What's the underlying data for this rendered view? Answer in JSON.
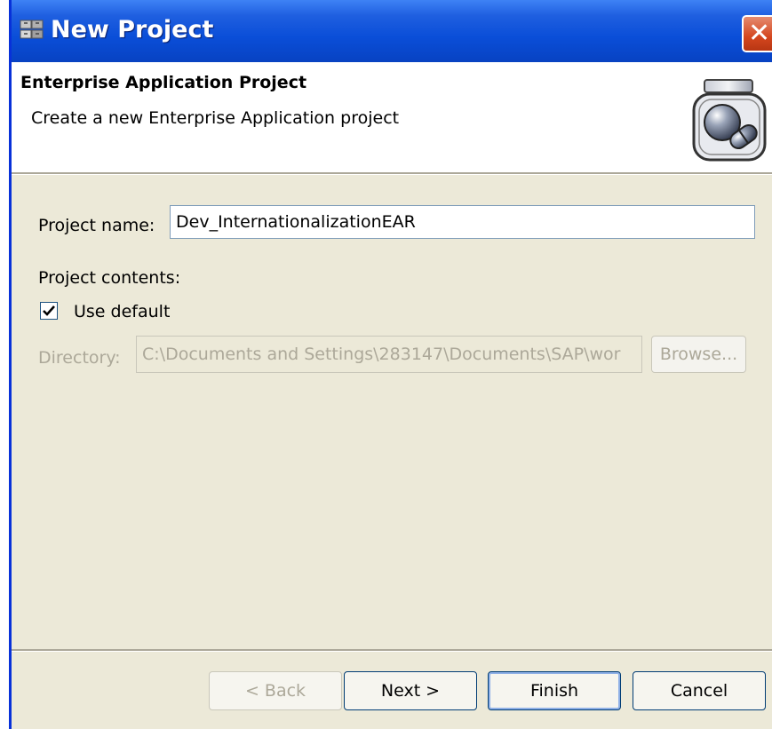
{
  "window": {
    "title": "New Project",
    "close_label": "✕"
  },
  "header": {
    "title": "Enterprise Application Project",
    "description": "Create a new Enterprise Application project",
    "icon": "jar-icon"
  },
  "form": {
    "project_name_label": "Project name:",
    "project_name_value": "Dev_InternationalizationEAR",
    "project_contents_label": "Project contents:",
    "use_default_label": "Use default",
    "use_default_checked": true,
    "directory_label": "Directory:",
    "directory_value": "C:\\Documents and Settings\\283147\\Documents\\SAP\\wor",
    "browse_label": "Browse..."
  },
  "buttons": {
    "back": "< Back",
    "next": "Next >",
    "finish": "Finish",
    "cancel": "Cancel"
  }
}
